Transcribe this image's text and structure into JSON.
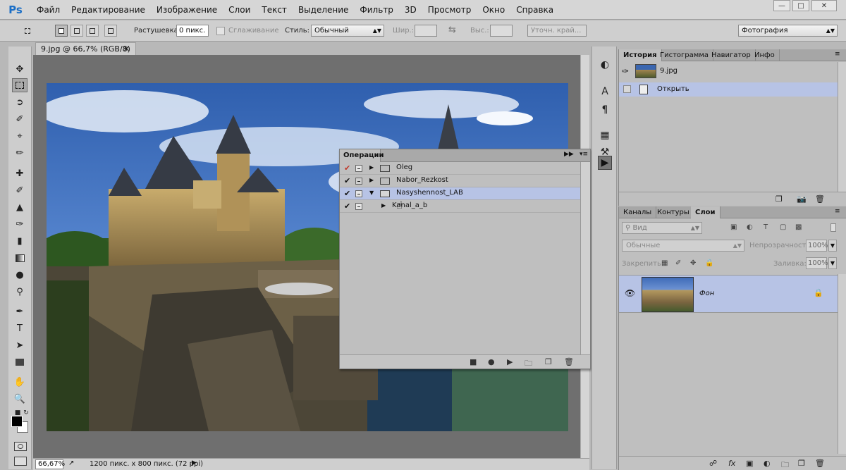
{
  "app": {
    "logo": "Ps"
  },
  "menu": [
    "Файл",
    "Редактирование",
    "Изображение",
    "Слои",
    "Текст",
    "Выделение",
    "Фильтр",
    "3D",
    "Просмотр",
    "Окно",
    "Справка"
  ],
  "options": {
    "feather_label": "Растушевка:",
    "feather_value": "0 пикс.",
    "antialias_label": "Сглаживание",
    "style_label": "Стиль:",
    "style_value": "Обычный",
    "width_label": "Шир.:",
    "height_label": "Выс.:",
    "refine_edge": "Уточн. край...",
    "workspace": "Фотография"
  },
  "document": {
    "tab_title": "9.jpg @ 66,7% (RGB/8)",
    "zoom": "66,67%",
    "size_info": "1200 пикс. x 800 пикс. (72 ppi)"
  },
  "actions_panel": {
    "title": "Операции",
    "rows": [
      {
        "label": "Oleg"
      },
      {
        "label": "Nabor_Rezkost"
      },
      {
        "label": "Nasyshennost_LAB"
      },
      {
        "label": "Kanal_a_b"
      }
    ]
  },
  "history_panel": {
    "tabs": [
      "История",
      "Гистограмма",
      "Навигатор",
      "Инфо"
    ],
    "snapshot": "9.jpg",
    "step": "Открыть"
  },
  "layers_panel": {
    "tabs": [
      "Каналы",
      "Контуры",
      "Слои"
    ],
    "filter_placeholder": "Вид",
    "blend_mode": "Обычные",
    "opacity_label": "Непрозрачность:",
    "opacity_value": "100%",
    "lock_label": "Закрепить:",
    "fill_label": "Заливка:",
    "fill_value": "100%",
    "layer_name": "Фон"
  },
  "colors": {
    "selection": "#b7c3e5",
    "panel": "#bfbfbf",
    "canvas_bg": "#6f6f6f"
  }
}
